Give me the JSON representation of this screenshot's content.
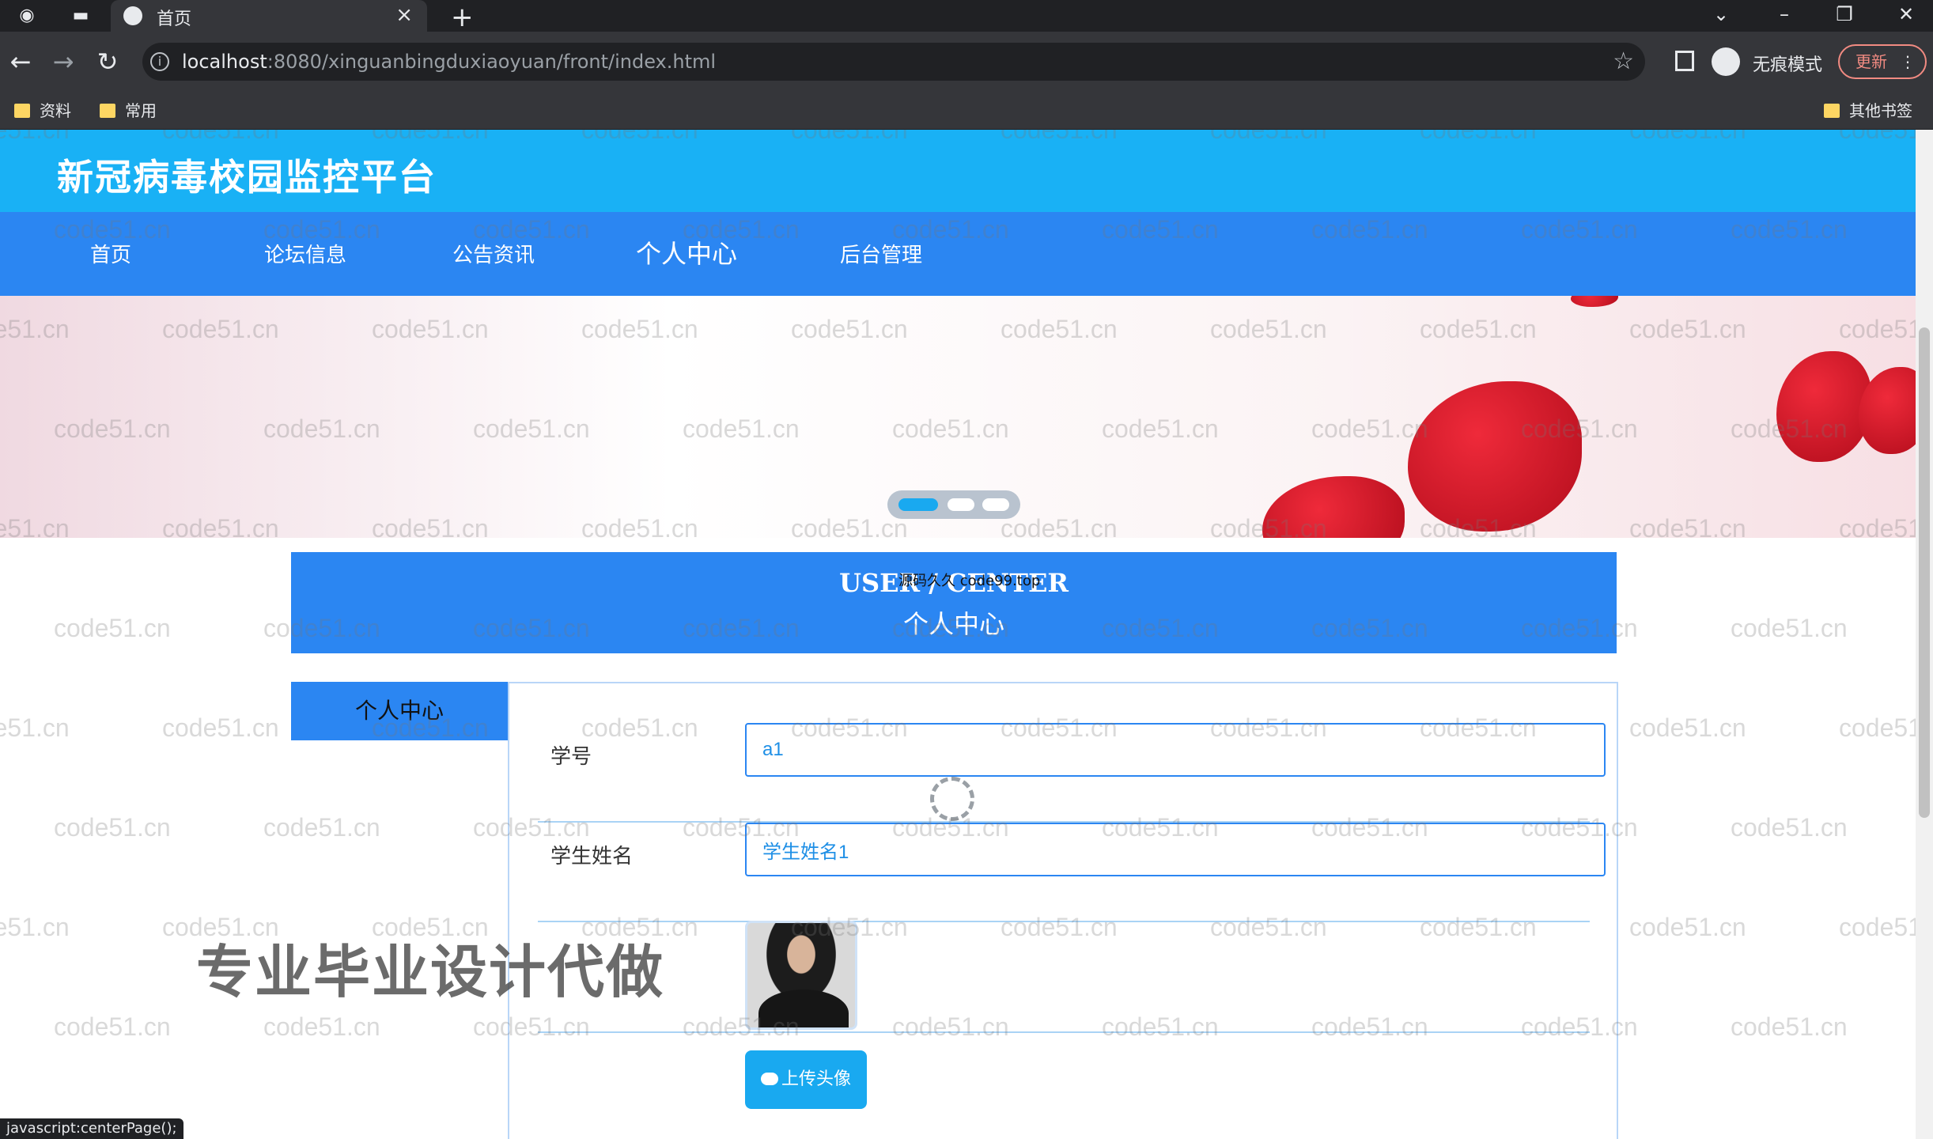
{
  "browser": {
    "tab_title": "首页",
    "tab_close": "×",
    "new_tab": "+",
    "url_host": "localhost",
    "url_rest": ":8080/xinguanbingduxiaoyuan/front/index.html",
    "incognito_label": "无痕模式",
    "update_label": "更新",
    "menu_dots": "⋮",
    "bookmarks": [
      "资料",
      "常用"
    ],
    "other_bookmarks": "其他书签",
    "status_text": "javascript:centerPage();"
  },
  "site": {
    "title": "新冠病毒校园监控平台",
    "nav": [
      "首页",
      "论坛信息",
      "公告资讯",
      "个人中心",
      "后台管理"
    ],
    "active_nav": "个人中心"
  },
  "user_center": {
    "title_en": "USER / CENTER",
    "title_zh": "个人中心",
    "side_menu_item": "个人中心",
    "fields": [
      {
        "label": "学号",
        "value": "a1"
      },
      {
        "label": "学生姓名",
        "value": "学生姓名1"
      }
    ],
    "upload_button": "上传头像"
  },
  "overlays": {
    "watermark": "code51.cn",
    "promo_text": "专业毕业设计代做",
    "note_text": "源码久久 code99.top"
  },
  "colors": {
    "header_bg": "#19b1f5",
    "nav_bg": "#2b86f2",
    "button_bg": "#19a9f0",
    "input_border": "#2b86f2"
  }
}
